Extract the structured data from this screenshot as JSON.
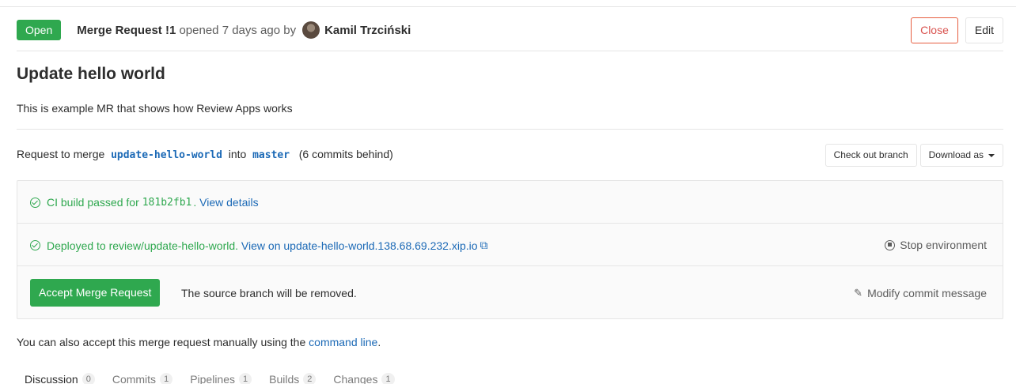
{
  "header": {
    "status": "Open",
    "mr_label": "Merge Request !1",
    "opened_text": "opened 7 days ago by",
    "author": "Kamil Trzciński",
    "close_label": "Close",
    "edit_label": "Edit"
  },
  "title": "Update hello world",
  "description": "This is example MR that shows how Review Apps works",
  "merge": {
    "prefix": "Request to merge",
    "source_branch": "update-hello-world",
    "into": "into",
    "target_branch": "master",
    "behind": "(6 commits behind)",
    "checkout_label": "Check out branch",
    "download_label": "Download as"
  },
  "widget": {
    "ci_text": "CI build passed for",
    "ci_sha": "181b2fb1",
    "ci_link": "View details",
    "deploy_text": "Deployed to review/update-hello-world.",
    "deploy_link": "View on update-hello-world.138.68.69.232.xip.io",
    "stop_label": "Stop environment",
    "accept_label": "Accept Merge Request",
    "remove_text": "The source branch will be removed.",
    "modify_label": "Modify commit message"
  },
  "manual": {
    "text": "You can also accept this merge request manually using the",
    "link": "command line",
    "end": "."
  },
  "tabs": [
    {
      "label": "Discussion",
      "count": "0"
    },
    {
      "label": "Commits",
      "count": "1"
    },
    {
      "label": "Pipelines",
      "count": "1"
    },
    {
      "label": "Builds",
      "count": "2"
    },
    {
      "label": "Changes",
      "count": "1"
    }
  ],
  "colors": {
    "success": "#2fa84f",
    "link": "#1b69b6",
    "danger": "#d9534f"
  }
}
